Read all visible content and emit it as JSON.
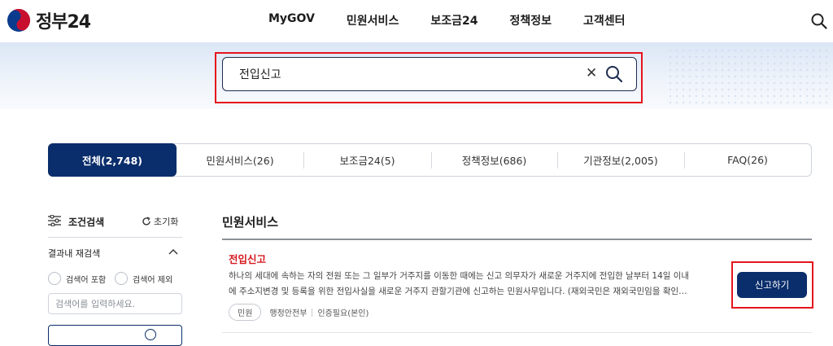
{
  "header": {
    "logo_text": "정부24",
    "nav": [
      "MyGOV",
      "민원서비스",
      "보조금24",
      "정책정보",
      "고객센터"
    ]
  },
  "search": {
    "value": "전입신고"
  },
  "tabs": [
    {
      "label": "전체(2,748)",
      "active": true
    },
    {
      "label": "민원서비스(26)",
      "active": false
    },
    {
      "label": "보조금24(5)",
      "active": false
    },
    {
      "label": "정책정보(686)",
      "active": false
    },
    {
      "label": "기관정보(2,005)",
      "active": false
    },
    {
      "label": "FAQ(26)",
      "active": false
    }
  ],
  "filter": {
    "title": "조건검색",
    "reset_label": "초기화",
    "refine_title": "결과내 재검색",
    "radio_include": "검색어 포함",
    "radio_exclude": "검색어 제외",
    "refine_placeholder": "검색어를 입력하세요."
  },
  "results": {
    "section_title": "민원서비스",
    "items": [
      {
        "title": "전입신고",
        "desc_line1": "하나의 세대에 속하는 자의 전원 또는 그 일부가 거주지를 이동한 때에는 신고 의무자가 새로운 거주지에 전입한 날부터 14일 이내",
        "desc_line2": "에 주소지변경 및 등록을 위한 전입사실을 새로운 거주지 관할기관에 신고하는 민원사무입니다. (재외국민은 재외국민임을 확인…",
        "tag": "민원",
        "agency": "행정안전부",
        "auth": "인증필요(본인)",
        "button": "신고하기"
      }
    ]
  },
  "colors": {
    "navy": "#0a2d6b",
    "highlight_red": "#e4141d",
    "title_red": "#d5191f"
  }
}
